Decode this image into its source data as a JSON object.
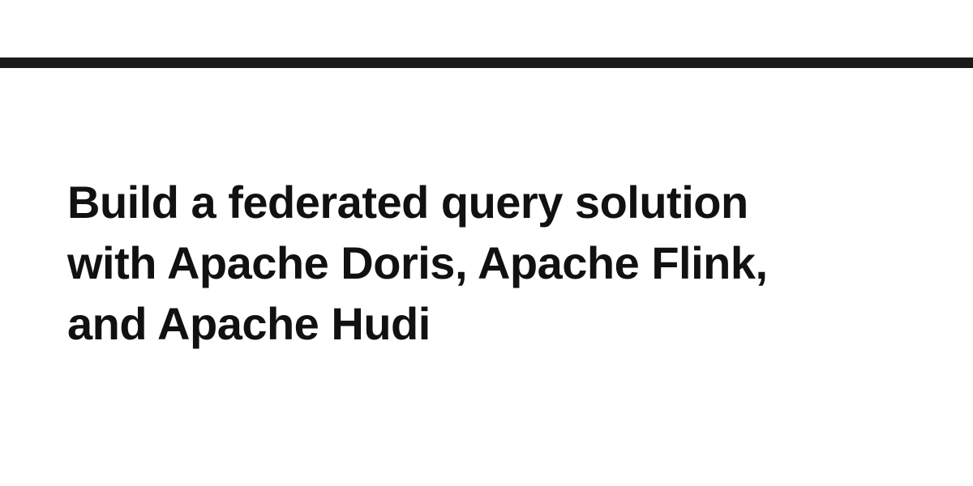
{
  "article": {
    "title_lines": [
      "Build a federated query solution",
      "with Apache Doris, Apache Flink,",
      "and Apache Hudi"
    ]
  }
}
